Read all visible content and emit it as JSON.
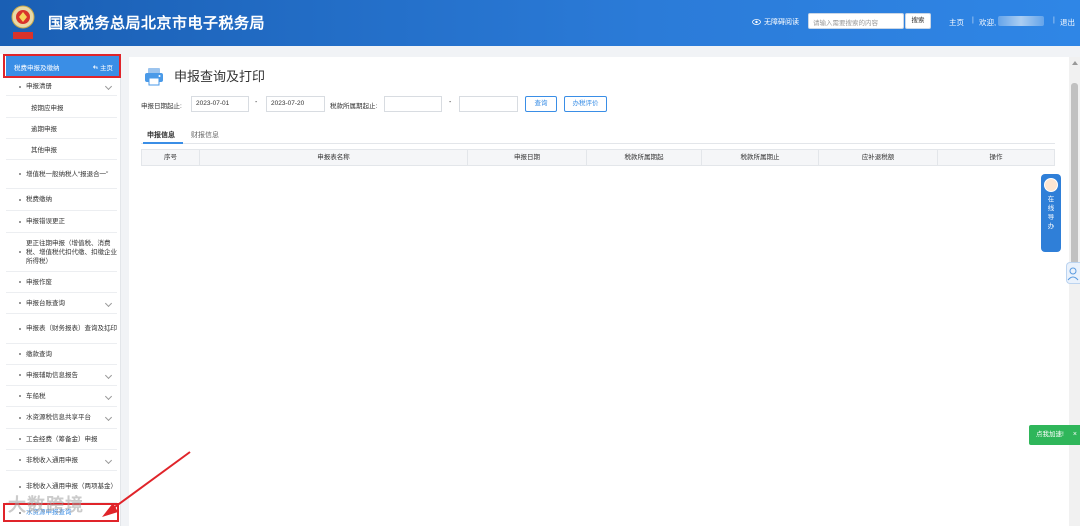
{
  "header": {
    "site_title": "国家税务总局北京市电子税务局",
    "emblem_text": "中国税务",
    "accessible_label": "无障碍阅读",
    "search_placeholder": "请输入需要搜索的内容",
    "search_button": "搜索",
    "home_link": "主页",
    "welcome_text": "欢迎,",
    "logout_link": "退出"
  },
  "sidebar": {
    "section_title": "税费申报及缴纳",
    "home_label": "主页",
    "items": [
      {
        "label": "申报清册",
        "expandable": true
      },
      {
        "label": "按期应申报",
        "sub": true
      },
      {
        "label": "逾期申报",
        "sub": true
      },
      {
        "label": "其他申报",
        "sub": true
      },
      {
        "label": "增值税一般纳税人“报退合一”",
        "expandable": false
      },
      {
        "label": "税费缴纳",
        "expandable": false
      },
      {
        "label": "申报错误更正",
        "expandable": false
      },
      {
        "label": "更正往期申报（增值税、消费税、增值税代扣代缴、扣缴企业所得税）",
        "expandable": false
      },
      {
        "label": "申报作废",
        "expandable": false
      },
      {
        "label": "申报台账查询",
        "expandable": true
      },
      {
        "label": "申报表（财务报表）查询及打印",
        "expandable": true
      },
      {
        "label": "缴款查询",
        "expandable": false
      },
      {
        "label": "申报辅助信息报告",
        "expandable": true
      },
      {
        "label": "车船税",
        "expandable": true
      },
      {
        "label": "水资源税信息共享平台",
        "expandable": true
      },
      {
        "label": "工会经费（筹备金）申报",
        "expandable": false
      },
      {
        "label": "非税收入通用申报",
        "expandable": true
      },
      {
        "label": "非税收入通用申报（两项基金）",
        "expandable": false
      },
      {
        "label": "水资源申报查询",
        "expandable": false
      }
    ]
  },
  "main": {
    "page_title": "申报查询及打印",
    "filters": {
      "report_date_label": "申报日期起止:",
      "report_date_start": "2023-07-01",
      "report_date_end": "2023-07-20",
      "tax_period_label": "税款所属期起止:",
      "tax_period_start": "",
      "tax_period_end": "",
      "dash": "-"
    },
    "buttons": {
      "query": "查询",
      "evaluate": "办税评价"
    },
    "tabs": [
      "申报信息",
      "财报信息"
    ],
    "table_headers": [
      "序号",
      "申报表名称",
      "申报日期",
      "税款所属期起",
      "税款所属期止",
      "应补退税额",
      "操作"
    ]
  },
  "widgets": {
    "online_help": "在线导办",
    "feedback": "点我加速!",
    "feedback_close": "×",
    "watermark": "大数跨境"
  },
  "colors": {
    "header_blue": "#1a5fb4",
    "accent_blue": "#3a8ee6",
    "highlight_red": "#e0242a",
    "feedback_green": "#2fb65a"
  }
}
